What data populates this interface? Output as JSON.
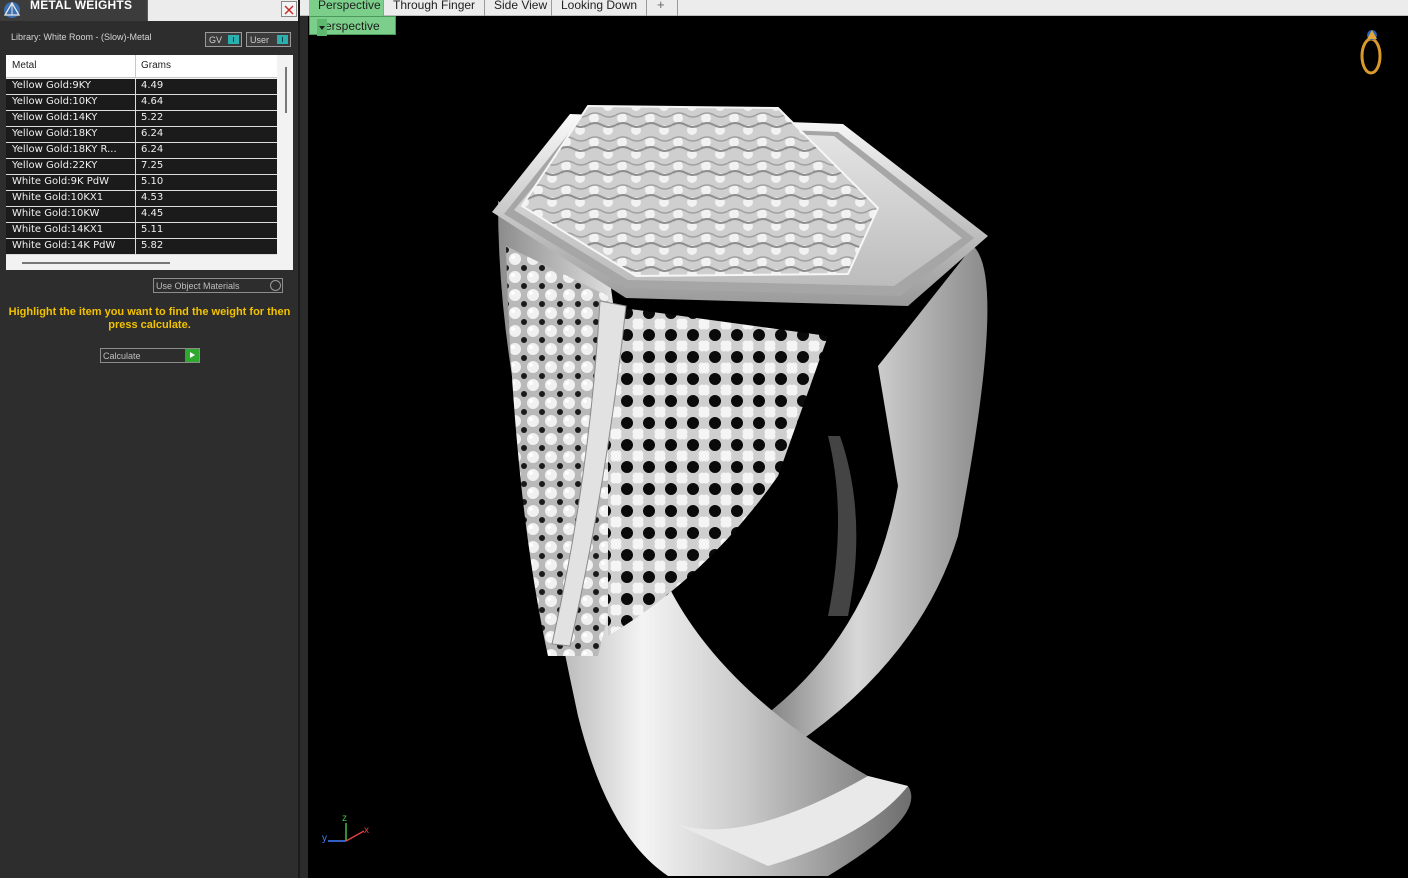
{
  "panel": {
    "title": "METAL WEIGHTS",
    "library_label": "Library: White Room - (Slow)-Metal",
    "toggle_gv": "GV",
    "toggle_user": "User",
    "columns": {
      "metal": "Metal",
      "grams": "Grams"
    },
    "rows": [
      {
        "metal": "Yellow Gold:9KY",
        "grams": "4.49"
      },
      {
        "metal": "Yellow Gold:10KY",
        "grams": "4.64"
      },
      {
        "metal": "Yellow Gold:14KY",
        "grams": "5.22"
      },
      {
        "metal": "Yellow Gold:18KY",
        "grams": "6.24"
      },
      {
        "metal": "Yellow Gold:18KY R...",
        "grams": "6.24"
      },
      {
        "metal": "Yellow Gold:22KY",
        "grams": "7.25"
      },
      {
        "metal": "White Gold:9K PdW",
        "grams": "5.10"
      },
      {
        "metal": "White Gold:10KX1",
        "grams": "4.53"
      },
      {
        "metal": "White Gold:10KW",
        "grams": "4.45"
      },
      {
        "metal": "White Gold:14KX1",
        "grams": "5.11"
      },
      {
        "metal": "White Gold:14K PdW",
        "grams": "5.82"
      }
    ],
    "use_object_materials": "Use Object Materials",
    "hint": "Highlight the item you want to find the weight for then press calculate.",
    "calculate_label": "Calculate"
  },
  "tabs": [
    {
      "label": "Perspective",
      "active": true
    },
    {
      "label": "Through Finger"
    },
    {
      "label": "Side View"
    },
    {
      "label": "Looking Down"
    },
    {
      "label": "+"
    }
  ],
  "viewport": {
    "view_label": "Perspective",
    "axis_labels": {
      "x": "x",
      "y": "y",
      "z": "z"
    }
  },
  "colors": {
    "active_tab": "#7ccf8a",
    "hint_text": "#f2c200",
    "toggle_knob": "#2bb0b0",
    "calculate_button": "#2ea82e",
    "viewport_bg": "#000000"
  }
}
